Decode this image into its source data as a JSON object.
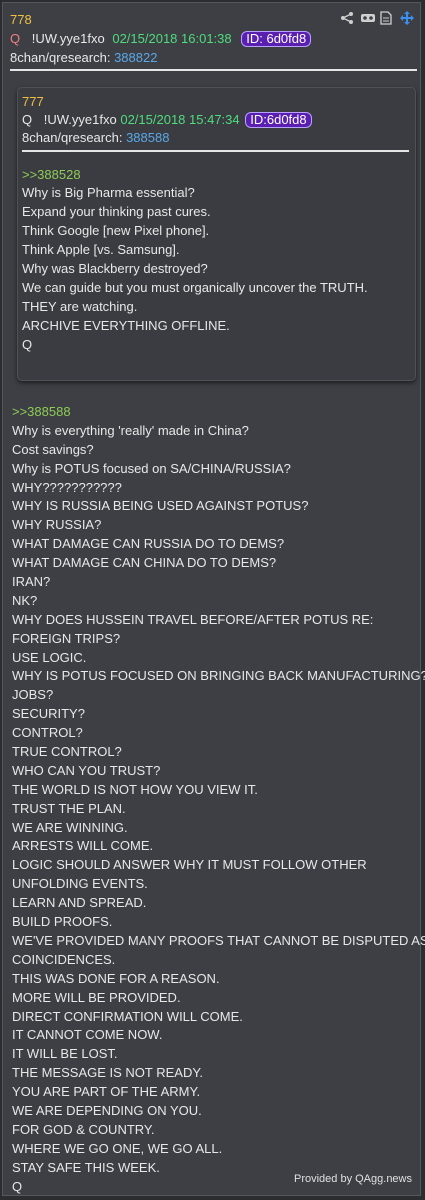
{
  "post": {
    "number": "778",
    "q": "Q",
    "trip": "!UW.yye1fxo",
    "datetime": "02/15/2018 16:01:38",
    "id": "ID: 6d0fd8",
    "board": "8chan/qresearch:",
    "board_link": "388822"
  },
  "icons": [
    "share-icon",
    "vr-icon",
    "document-icon",
    "move-icon"
  ],
  "quoted": {
    "number": "777",
    "q": "Q",
    "trip": "!UW.yye1fxo",
    "datetime": "02/15/2018 15:47:34",
    "id": "ID:6d0fd8",
    "board": "8chan/qresearch:",
    "board_link": "388588",
    "reply_ref": ">>388528",
    "lines": [
      "Why is Big Pharma essential?",
      "Expand your thinking past cures.",
      "Think Google [new Pixel phone].",
      "Think Apple [vs. Samsung].",
      "Why was Blackberry destroyed?",
      "We can guide but you must organically uncover the TRUTH.",
      "THEY are watching.",
      "ARCHIVE EVERYTHING OFFLINE.",
      "Q"
    ]
  },
  "body": {
    "reply_ref": ">>388588",
    "lines": [
      "Why is everything 'really' made in China?",
      "Cost savings?",
      "Why is POTUS focused on SA/CHINA/RUSSIA?",
      "WHY???????????",
      "WHY IS RUSSIA BEING USED AGAINST POTUS?",
      "WHY RUSSIA?",
      "WHAT DAMAGE CAN RUSSIA DO TO DEMS?",
      "WHAT DAMAGE CAN CHINA DO TO DEMS?",
      "IRAN?",
      "NK?",
      "WHY DOES HUSSEIN TRAVEL BEFORE/AFTER POTUS RE:",
      "FOREIGN TRIPS?",
      "USE LOGIC.",
      "WHY IS POTUS FOCUSED ON BRINGING BACK MANUFACTURING?",
      "JOBS?",
      "SECURITY?",
      "CONTROL?",
      "TRUE CONTROL?",
      "WHO CAN YOU TRUST?",
      "THE WORLD IS NOT HOW YOU VIEW IT.",
      "TRUST THE PLAN.",
      "WE ARE WINNING.",
      "ARRESTS WILL COME.",
      "LOGIC SHOULD ANSWER WHY IT MUST FOLLOW OTHER",
      "UNFOLDING EVENTS.",
      "LEARN AND SPREAD.",
      "BUILD PROOFS.",
      "WE'VE PROVIDED MANY PROOFS THAT CANNOT BE DISPUTED AS",
      "COINCIDENCES.",
      "THIS WAS DONE FOR A REASON.",
      "MORE WILL BE PROVIDED.",
      "DIRECT CONFIRMATION WILL COME.",
      "IT CANNOT COME NOW.",
      "IT WILL BE LOST.",
      "THE MESSAGE IS NOT READY.",
      "YOU ARE PART OF THE ARMY.",
      "WE ARE DEPENDING ON YOU.",
      "FOR GOD & COUNTRY.",
      "WHERE WE GO ONE, WE GO ALL.",
      "STAY SAFE THIS WEEK.",
      "Q"
    ]
  },
  "footer": {
    "credit": "Provided by QAgg.news"
  }
}
